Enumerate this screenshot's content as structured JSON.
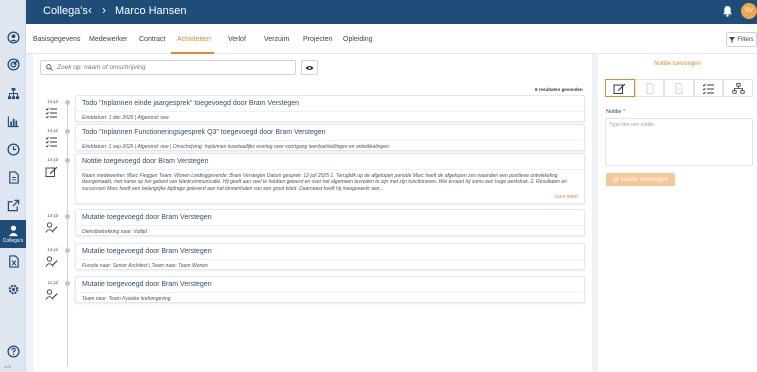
{
  "header": {
    "brand": "Collega's",
    "person": "Marco Hansen",
    "avatar_initials": "BV"
  },
  "rail": {
    "active_label": "Collega's",
    "version": "v.72"
  },
  "tabs": [
    "Basisgegevens",
    "Medewerker",
    "Contract",
    "Activiteiten",
    "Verlof",
    "Verzuim",
    "Projecten",
    "Opleiding"
  ],
  "active_tab": "Activiteiten",
  "filters_label": "Filters",
  "search": {
    "placeholder": "Zoek op: naam of omschrijving"
  },
  "results_text": "6 resultaten gevonden",
  "entries": [
    {
      "date": "14 jul",
      "icon": "todo-icon",
      "title": "Todo \"Inplannen einde jaargesprek\" toegevoegd door Bram Verstegen",
      "sub": "Einddatum: 1 dec 2025 | Afgerond: nee"
    },
    {
      "date": "14 jul",
      "icon": "todo-icon",
      "title": "Todo \"Inplannen Functioneringsgesprek Q3\" toegevoegd door Bram Verstegen",
      "sub": "Einddatum: 1 sep 2025 | Afgerond: nee | Omschrijving: Inplannen kwartaallijks overleg over voortgang leerdoelstellingen en ontwikkelingen."
    },
    {
      "date": "14 jul",
      "icon": "note-icon",
      "title": "Notitie toegevoegd door Bram Verstegen",
      "body": "Naam medewerker: Marc Fieggen Team: Wonen Leidinggevende: Bram Verstegen Datum gesprek: 12 juli 2025 1. Terugblik op de afgelopen periode Marc heeft de afgelopen zes maanden een positieve ontwikkeling doorgemaakt, met name op het gebied van klantcommunicatie. Hij geeft aan veel te hebben geleerd en over het algemeen tevreden te zijn met zijn functioneren. Wel ervaart hij soms een hoge werkdruk. 2. Resultaten en successen Marc heeft een belangrijke bijdrage geleverd aan het binnenhalen van een groot klant. Daarnaast heeft hij meegewerkt aan...",
      "more": "Lees meer"
    },
    {
      "date": "14 jul",
      "icon": "user-edit-icon",
      "title": "Mutatie toegevoegd door Bram Verstegen",
      "sub": "Dienstbetrekking naar: Voltijd"
    },
    {
      "date": "14 jul",
      "icon": "user-edit-icon",
      "title": "Mutatie toegevoegd door Bram Verstegen",
      "sub": "Functie naar: Senior Architect | Team naar: Team Wonen"
    },
    {
      "date": "11 jul",
      "icon": "user-edit-icon",
      "title": "Mutatie toegevoegd door Bram Verstegen",
      "sub": "Team naar: Team Fysieke leefomgeving"
    }
  ],
  "side": {
    "title": "Notitie toevoegen",
    "field_label": "Notitie",
    "required_mark": "*",
    "placeholder": "Type hier een notitie",
    "button_label": "Notitie toevoegen"
  },
  "colors": {
    "primary": "#1f4d7a",
    "accent": "#e28a2b"
  }
}
